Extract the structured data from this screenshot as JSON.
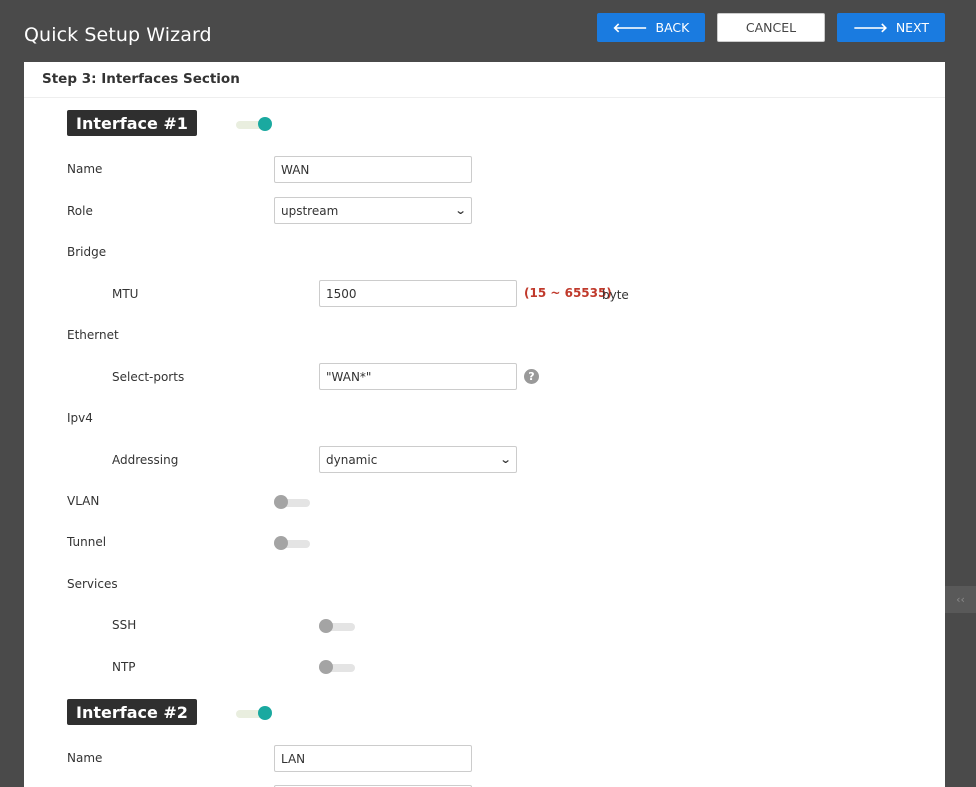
{
  "header": {
    "title": "Quick Setup Wizard",
    "back_label": "BACK",
    "cancel_label": "CANCEL",
    "next_label": "NEXT",
    "back_icon": "arrow-left-icon",
    "next_icon": "arrow-right-icon"
  },
  "step": {
    "title": "Step 3: Interfaces Section"
  },
  "interfaces": [
    {
      "badge": "Interface #1",
      "enabled": true,
      "name_label": "Name",
      "name_value": "WAN",
      "role_label": "Role",
      "role_value": "upstream",
      "bridge_label": "Bridge",
      "mtu_label": "MTU",
      "mtu_value": "1500",
      "mtu_range": "(15 ~ 65535)",
      "mtu_unit": "byte",
      "ethernet_label": "Ethernet",
      "select_ports_label": "Select-ports",
      "select_ports_value": "\"WAN*\"",
      "ipv4_label": "Ipv4",
      "addressing_label": "Addressing",
      "addressing_value": "dynamic",
      "vlan_label": "VLAN",
      "vlan_enabled": false,
      "tunnel_label": "Tunnel",
      "tunnel_enabled": false,
      "services_label": "Services",
      "ssh_label": "SSH",
      "ssh_enabled": false,
      "ntp_label": "NTP",
      "ntp_enabled": false
    },
    {
      "badge": "Interface #2",
      "enabled": true,
      "name_label": "Name",
      "name_value": "LAN"
    }
  ],
  "colors": {
    "primary": "#1a7be0",
    "toggle_on": "#1aa9a0",
    "range_text": "#c0392b",
    "header_bg": "#4a4a4a"
  }
}
